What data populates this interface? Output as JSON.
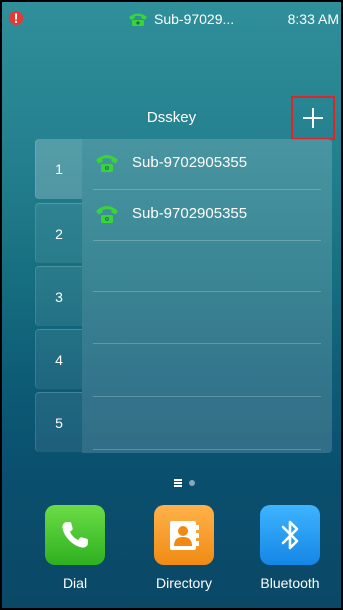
{
  "status_bar": {
    "account_label": "Sub-97029...",
    "time": "8:33 AM",
    "alert_icon": "alert-triangle-icon",
    "account_icon": "phone-handset-icon"
  },
  "header": {
    "title": "Dsskey",
    "add_icon": "plus-icon"
  },
  "dsskey": {
    "tabs": [
      {
        "label": "1"
      },
      {
        "label": "2"
      },
      {
        "label": "3"
      },
      {
        "label": "4"
      },
      {
        "label": "5"
      }
    ],
    "active_tab": "1",
    "rows": [
      {
        "label": "Sub-9702905355",
        "icon": "line-key-icon"
      },
      {
        "label": "Sub-9702905355",
        "icon": "line-key-icon"
      },
      {
        "label": ""
      },
      {
        "label": ""
      },
      {
        "label": ""
      },
      {
        "label": ""
      }
    ]
  },
  "pager": {
    "pages": 2,
    "current": 1
  },
  "dock": {
    "items": [
      {
        "label": "Dial",
        "icon": "phone-icon",
        "color": "#3cc22a"
      },
      {
        "label": "Directory",
        "icon": "contact-icon",
        "color": "#f59a1e"
      },
      {
        "label": "Bluetooth",
        "icon": "bluetooth-icon",
        "color": "#1e93f0"
      }
    ]
  },
  "colors": {
    "highlight_border": "#e0252a",
    "status_green": "#39d33a",
    "alert_red": "#e53935"
  }
}
